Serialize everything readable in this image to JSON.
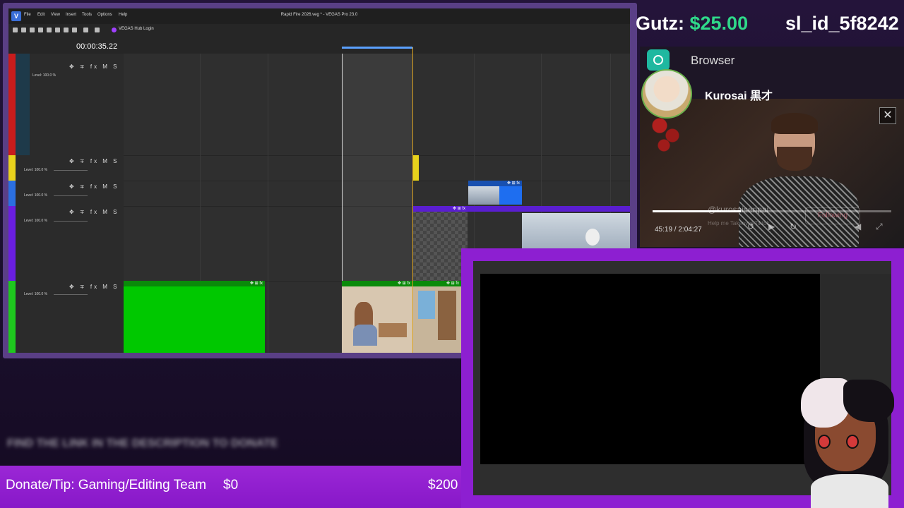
{
  "vegas": {
    "window_title": "Rapid Fire 2026.veg * - VEGAS Pro 23.0",
    "menu": [
      "File",
      "Edit",
      "View",
      "Insert",
      "Tools",
      "Options",
      "Help"
    ],
    "hub_login": "VEGAS Hub Login",
    "timecode": "00:00:35.22",
    "track_buttons": "✥ ∓ fx M S",
    "tracks": [
      {
        "level": "Level: 100.0 %",
        "color": "#c81c1c"
      },
      {
        "level": "Level: 100.0 %",
        "color": "#e8d21c"
      },
      {
        "level": "Level: 100.0 %",
        "color": "#2b6fe0"
      },
      {
        "level": "Level: 100.0 %",
        "color": "#6a1ee0"
      },
      {
        "level": "Level: 100.0 %",
        "color": "#1ec81e"
      }
    ]
  },
  "overlay": {
    "gutz_label": "Gutz:",
    "gutz_amount": "$25.00",
    "session_id": "sl_id_5f8242"
  },
  "browser_source": {
    "label": "Browser",
    "channel_name": "Kurosai 黒才",
    "handle": "@kurosaisenpai",
    "help_text": "Help me Takeover Tiktok",
    "following_label": "Following",
    "video_time": "45:19 / 2:04:27",
    "progress_fraction": 0.37
  },
  "donation": {
    "blurred_text": "FIND THE LINK IN THE DESCRIPTION TO DONATE",
    "label": "Donate/Tip: Gaming/Editing Team",
    "current": "$0",
    "goal": "$200"
  },
  "colors": {
    "frame_purple": "#8d1fd1",
    "money_green": "#2fd98a",
    "clip_green": "#00c800"
  }
}
